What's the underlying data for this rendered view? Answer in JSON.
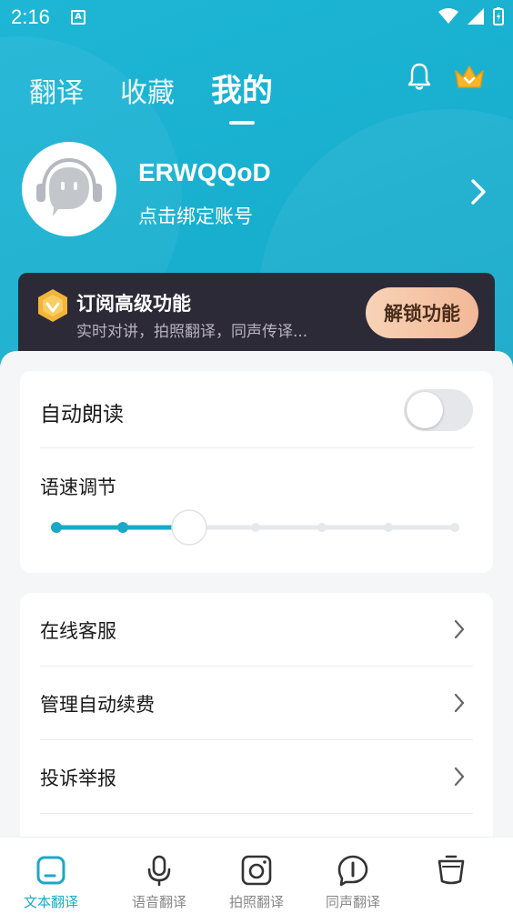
{
  "status_bar": {
    "time": "2:16",
    "a_icon": "A"
  },
  "top_nav": {
    "tabs": [
      {
        "label": "翻译",
        "active": false
      },
      {
        "label": "收藏",
        "active": false
      },
      {
        "label": "我的",
        "active": true
      }
    ]
  },
  "profile": {
    "username": "ERWQQoD",
    "bind_text": "点击绑定账号"
  },
  "subscription": {
    "title": "订阅高级功能",
    "description": "实时对讲，拍照翻译，同声传译...",
    "button": "解锁功能"
  },
  "settings": {
    "auto_read_label": "自动朗读",
    "auto_read_enabled": false,
    "speed_label": "语速调节",
    "speed_steps": 7,
    "speed_current_step": 3
  },
  "menu": {
    "items": [
      {
        "label": "在线客服"
      },
      {
        "label": "管理自动续费"
      },
      {
        "label": "投诉举报"
      }
    ]
  },
  "bottom_tabs": [
    {
      "label": "文本翻译",
      "icon": "text-translate-icon",
      "active": true
    },
    {
      "label": "语音翻译",
      "icon": "microphone-icon",
      "active": false
    },
    {
      "label": "拍照翻译",
      "icon": "camera-icon",
      "active": false
    },
    {
      "label": "同声翻译",
      "icon": "simultaneous-icon",
      "active": false
    },
    {
      "label": "",
      "icon": "cup-icon",
      "active": false
    }
  ],
  "colors": {
    "accent": "#1aa8c8",
    "hero": "#1fb6d6",
    "sub_card": "#2d2a38",
    "unlock": "#f4c1a0"
  }
}
